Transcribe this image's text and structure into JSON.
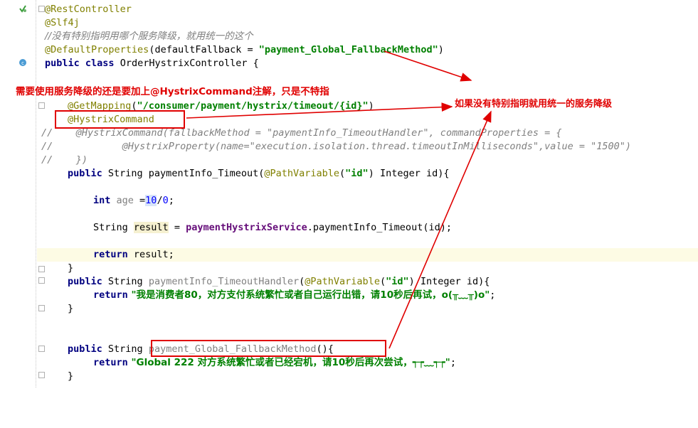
{
  "code": {
    "l1": "@RestController",
    "l2": "@Slf4j",
    "l3": "//没有特别指明用哪个服务降级，就用统一的这个",
    "l4_ann": "@DefaultProperties",
    "l4_open": "(defaultFallback = ",
    "l4_str": "\"payment_Global_FallbackMethod\"",
    "l4_close": ")",
    "l5_kw1": "public",
    "l5_kw2": "class",
    "l5_rest": " OrderHystrixController {",
    "l6_ann": "@GetMapping",
    "l6_open": "(",
    "l6_str": "\"/consumer/payment/hystrix/timeout/{id}\"",
    "l6_close": ")",
    "l7_ann": "@HystrixCommand",
    "l8": "//    @HystrixCommand(fallbackMethod = \"paymentInfo_TimeoutHandler\", commandProperties = {",
    "l9": "//            @HystrixProperty(name=\"execution.isolation.thread.timeoutInMilliseconds\",value = \"1500\")",
    "l10": "//    })",
    "l11_kw": "public",
    "l11_a": " String paymentInfo_Timeout(",
    "l11_ann": "@PathVariable",
    "l11_b": "(",
    "l11_str": "\"id\"",
    "l11_c": ") Integer id){",
    "l12_kw": "int",
    "l12_var": " age ",
    "l12_eq": "=",
    "l12_n1": "10",
    "l12_slash": "/",
    "l12_n2": "0",
    "l12_end": ";",
    "l13_type": "String ",
    "l13_var": "result",
    "l13_eq": " = ",
    "l13_fld": "paymentHystrixService",
    "l13_call": ".paymentInfo_Timeout(id);",
    "l14_kw": "return",
    "l14_rest": " result;",
    "l15": "}",
    "l16_kw": "public",
    "l16_a": " String ",
    "l16_name": "paymentInfo_TimeoutHandler",
    "l16_b": "(",
    "l16_ann": "@PathVariable",
    "l16_c": "(",
    "l16_str": "\"id\"",
    "l16_d": ") Integer id){",
    "l17_kw": "return",
    "l17_str": " \"我是消费者80，对方支付系统繁忙或者自己运行出错，请10秒后再试，o(╥﹏╥)o\"",
    "l17_end": ";",
    "l18": "}",
    "l19_kw": "public",
    "l19_a": " String ",
    "l19_name": "payment_Global_FallbackMethod",
    "l19_b": "(){",
    "l20_kw": "return",
    "l20_str": " \"Global 222 对方系统繁忙或者已经宕机，请10秒后再次尝试，┭┮﹏┭┮\"",
    "l20_end": ";",
    "l21": "}"
  },
  "annotations": {
    "note_left": "需要使用服务降级的还是要加上@HystrixCommand注解，只是不特指",
    "note_right": "如果没有特别指明就用统一的服务降级"
  },
  "colors": {
    "annotation_red": "#e00000",
    "keyword": "#000080",
    "string": "#008000",
    "annotation": "#808000",
    "comment": "#808080"
  }
}
